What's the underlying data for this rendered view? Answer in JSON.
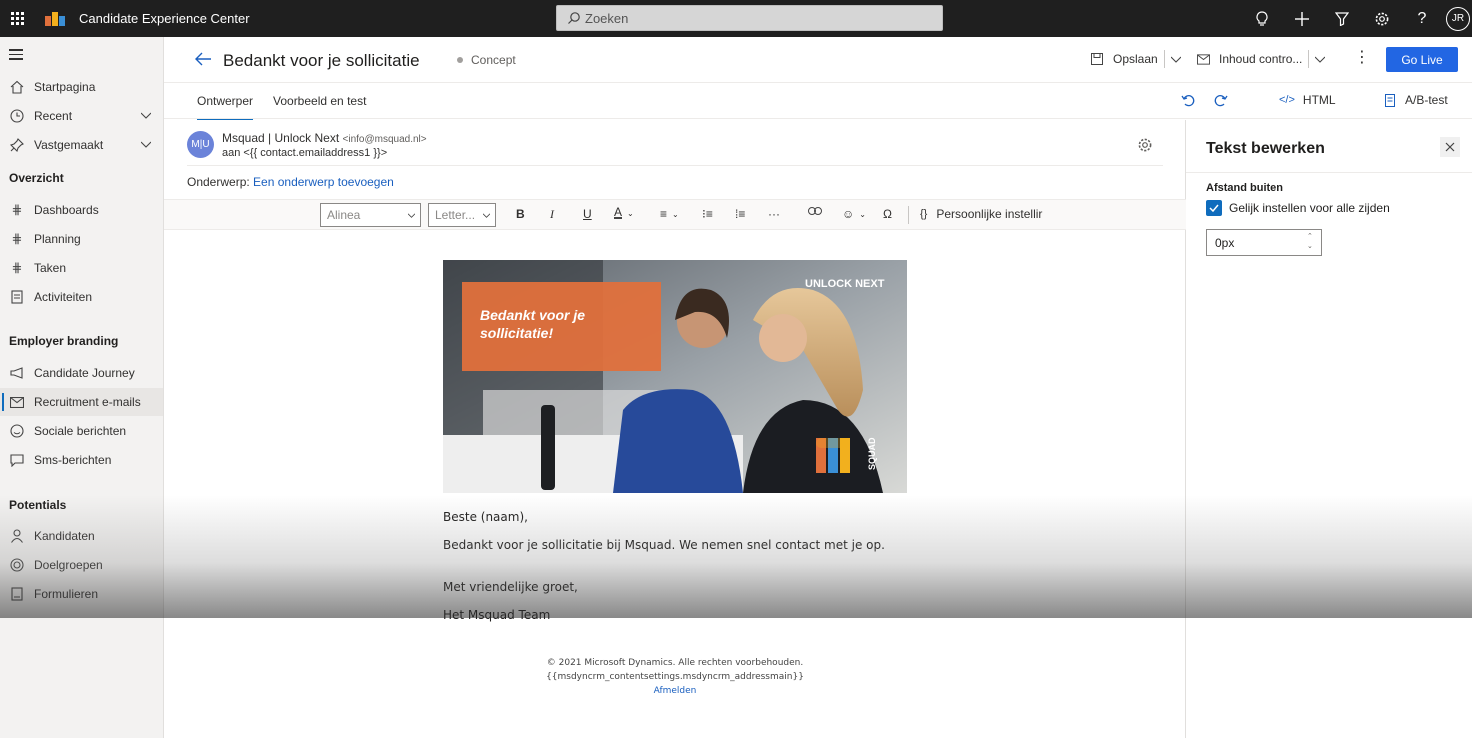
{
  "app": {
    "title": "Candidate Experience Center",
    "user_initials": "JR"
  },
  "search": {
    "placeholder": "Zoeken"
  },
  "sidebar": {
    "items_top": [
      {
        "label": "Startpagina",
        "icon": "home-icon"
      },
      {
        "label": "Recent",
        "icon": "clock-icon"
      },
      {
        "label": "Vastgemaakt",
        "icon": "pin-icon"
      }
    ],
    "sections": [
      {
        "title": "Overzicht",
        "items": [
          "Dashboards",
          "Planning",
          "Taken",
          "Activiteiten"
        ]
      },
      {
        "title": "Employer branding",
        "items": [
          "Candidate Journey",
          "Recruitment e-mails",
          "Sociale berichten",
          "Sms-berichten"
        ]
      },
      {
        "title": "Potentials",
        "items": [
          "Kandidaten",
          "Doelgroepen",
          "Formulieren"
        ]
      }
    ],
    "active_item": "Recruitment e-mails"
  },
  "header": {
    "title": "Bedankt voor je sollicitatie",
    "status": "Concept",
    "save_label": "Opslaan",
    "check_label": "Inhoud contro...",
    "golive_label": "Go Live"
  },
  "tabs": {
    "designer": "Ontwerper",
    "preview": "Voorbeeld en test",
    "html": "HTML",
    "abtest": "A/B-test"
  },
  "email": {
    "from_initials": "M|U",
    "from_name": "Msquad | Unlock Next",
    "from_address": "<info@msquad.nl>",
    "to_line": "aan <{{ contact.emailaddress1 }}>",
    "subject_label": "Onderwerp:",
    "subject_link": "Een onderwerp toevoegen"
  },
  "toolbar": {
    "paragraph": "Alinea",
    "font": "Letter...",
    "personal": "Persoonlijke instellir"
  },
  "hero": {
    "headline": "Bedankt voor je sollicitatie!",
    "brand": "UNLOCK NEXT",
    "logo_text": "SQUAD"
  },
  "body": {
    "greeting": "Beste (naam),",
    "line1": "Bedankt voor je sollicitatie bij Msquad. We nemen snel contact met je op.",
    "closing": "Met vriendelijke groet,",
    "signature": "Het Msquad Team"
  },
  "footer": {
    "copyright": "© 2021 Microsoft Dynamics. Alle rechten voorbehouden.",
    "address": "{{msdyncrm_contentsettings.msdyncrm_addressmain}}",
    "unsubscribe": "Afmelden"
  },
  "panel": {
    "title": "Tekst bewerken",
    "section_label": "Afstand buiten",
    "checkbox_label": "Gelijk instellen voor alle zijden",
    "checkbox_checked": true,
    "value": "0px"
  },
  "colors": {
    "accent": "#2266e3",
    "hero_orange": "#e0703c",
    "topbar": "#1f1f1f"
  }
}
